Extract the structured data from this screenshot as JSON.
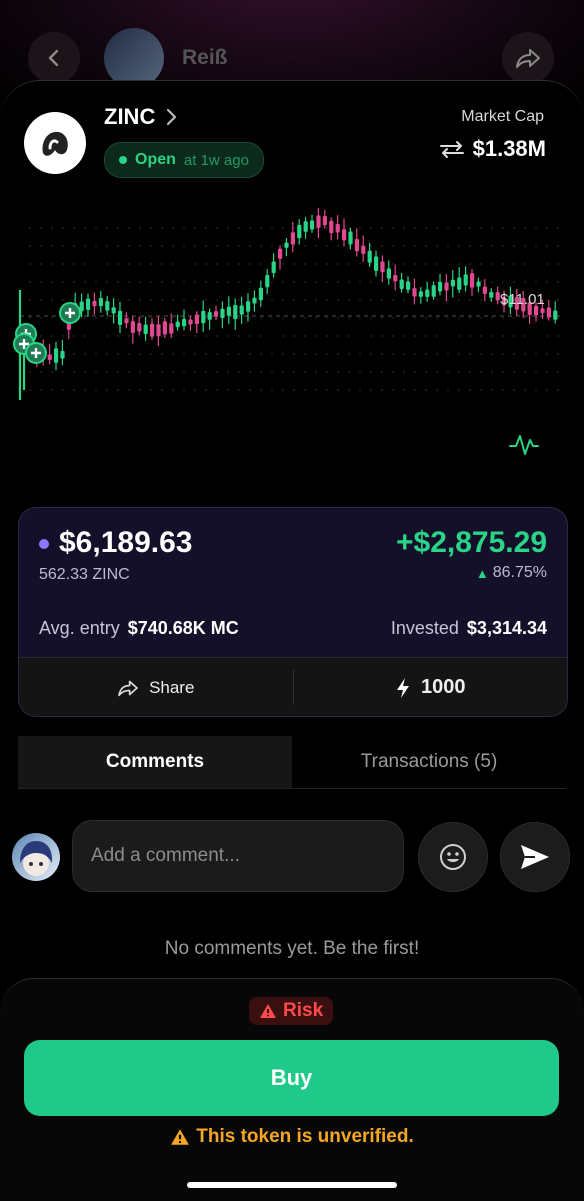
{
  "header": {
    "username": "Reiß"
  },
  "token": {
    "name": "ZINC",
    "status": "Open",
    "status_age": "at 1w ago",
    "market_cap_label": "Market Cap",
    "market_cap_value": "$1.38M"
  },
  "chart": {
    "price_label": "$11.01",
    "colors": {
      "up": "#2ad486",
      "down": "#e0488f"
    }
  },
  "position": {
    "value": "$6,189.63",
    "quantity": "562.33 ZINC",
    "pnl": "+$2,875.29",
    "pnl_pct": "86.75%",
    "avg_entry_label": "Avg. entry",
    "avg_entry_value": "$740.68K MC",
    "invested_label": "Invested",
    "invested_value": "$3,314.34",
    "share_label": "Share",
    "quick_buy_amount": "1000"
  },
  "tabs": [
    {
      "label": "Comments",
      "active": true
    },
    {
      "label": "Transactions (5)",
      "active": false
    }
  ],
  "comments": {
    "placeholder": "Add a comment...",
    "empty_text": "No comments yet. Be the first!"
  },
  "footer": {
    "risk_label": "Risk",
    "buy_label": "Buy",
    "warning": "This token is unverified."
  }
}
